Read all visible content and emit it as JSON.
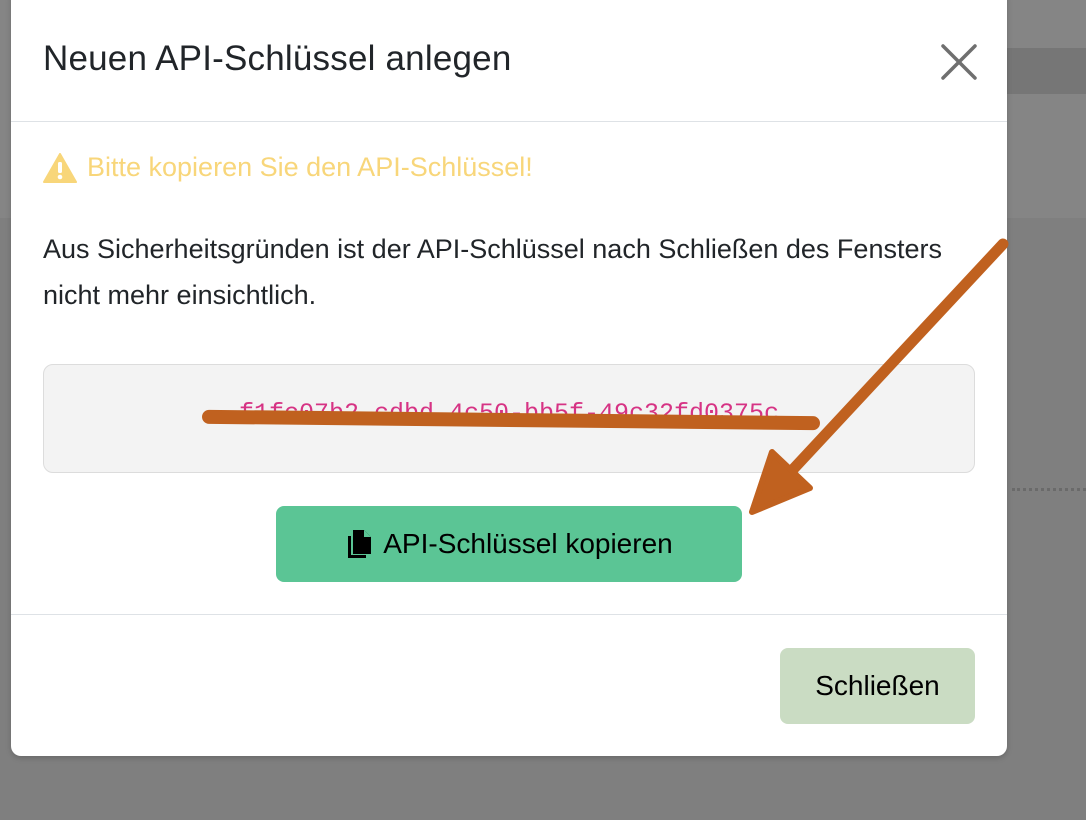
{
  "modal": {
    "title": "Neuen API-Schlüssel anlegen",
    "warning_text": "Bitte kopieren Sie den API-Schlüssel!",
    "info_text": "Aus Sicherheitsgründen ist der API-Schlüssel nach Schließen des Fensters nicht mehr einsichtlich.",
    "api_key_redacted": "f1fc07b2-cdbd-4c50-bb5f-49c32fd0375c",
    "copy_button_label": "API-Schlüssel kopieren",
    "close_button_label": "Schließen"
  },
  "icons": {
    "close": "close-icon",
    "warning": "warning-icon",
    "copy": "copy-icon"
  },
  "colors": {
    "warning": "#f8d67a",
    "key_text": "#d63384",
    "copy_button": "#5bc595",
    "close_button": "#cadcc3",
    "annotation": "#c0611f",
    "backdrop": "#7f7f7f"
  }
}
